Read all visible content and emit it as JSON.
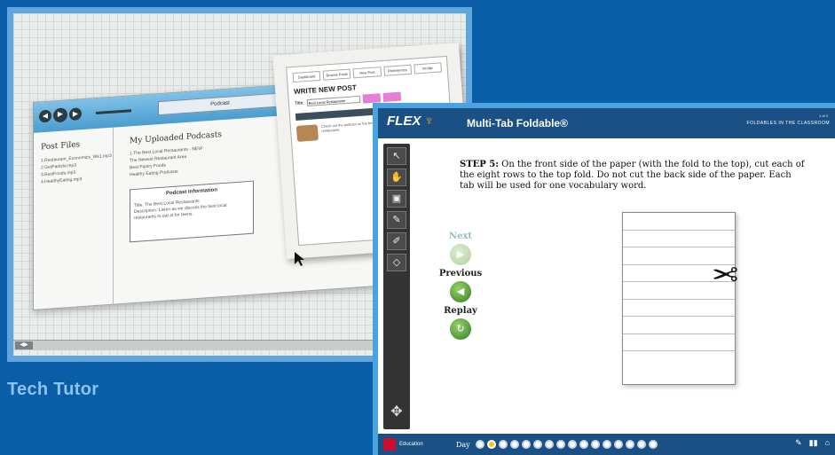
{
  "caption": "Tech Tutor",
  "tech_tutor": {
    "player_title": "Podcast",
    "post_files_heading": "Post Files",
    "post_files": [
      "1.Restaurant_Economics_Wk1.mp3",
      "2.GetParticle.mp3",
      "3.BestFoods.mp3",
      "4.HealthyEating.mp3"
    ],
    "uploaded_heading": "My Uploaded Podcasts",
    "uploaded_items": [
      "1.The Best Local Restaurants - NEW",
      "The Newest Restaurant Area",
      "Best Pastry Foods",
      "Healthy Eating Podcasts"
    ],
    "info_heading": "Podcast Information",
    "info_lines": [
      "Title: The Best Local Restaurants",
      "Description: Listen as we discuss the best local restaurants to eat at for teens."
    ],
    "post_tabs": [
      "Dashboard",
      "Browse Posts",
      "New Post",
      "Preferences",
      "Profile"
    ],
    "post_title": "WRITE NEW POST",
    "post_field_label": "Title:",
    "post_field_value": "Best Local Restaurants",
    "post_body": "Check out the podcast on the best local restaurants."
  },
  "flex": {
    "brand": "FLEX",
    "lesson_title": "Multi-Tab Foldable®",
    "top_right_small": "1 of 3",
    "top_right": "FOLDABLES IN THE CLASSROOM",
    "step_label": "STEP 5:",
    "step_text": "On the front side of the paper (with the fold to the top), cut each of the eight rows to the top fold. Do not cut the back side of the paper. Each tab will be used for one vocabulary word.",
    "nav": {
      "next": "Next",
      "previous": "Previous",
      "replay": "Replay"
    },
    "tools": [
      "pointer-icon",
      "hand-icon",
      "box-icon",
      "pencil-icon",
      "marker-icon",
      "eraser-icon"
    ],
    "bottom": {
      "publisher": "Education",
      "day_label": "Day",
      "dot_count": 16,
      "current_dot": 2
    }
  }
}
